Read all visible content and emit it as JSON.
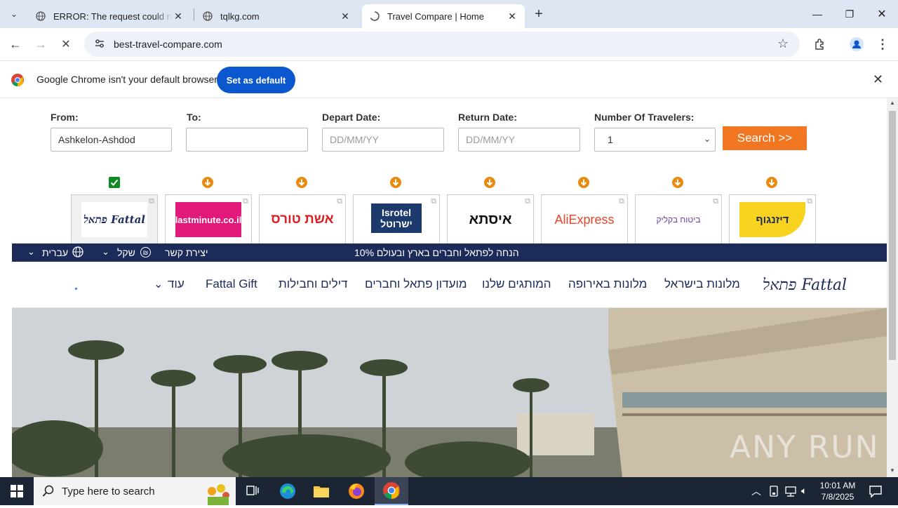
{
  "browser": {
    "tabs": [
      {
        "title": "ERROR: The request could not b",
        "active": false
      },
      {
        "title": "tqlkg.com",
        "active": false
      },
      {
        "title": "Travel Compare | Home",
        "active": true
      }
    ],
    "url": "best-travel-compare.com"
  },
  "infobar": {
    "message": "Google Chrome isn't your default browser",
    "button": "Set as default"
  },
  "form": {
    "from_label": "From:",
    "from_value": "Ashkelon-Ashdod",
    "to_label": "To:",
    "to_value": "",
    "depart_label": "Depart Date:",
    "depart_placeholder": "DD/MM/YY",
    "return_label": "Return Date:",
    "return_placeholder": "DD/MM/YY",
    "travelers_label": "Number Of Travelers:",
    "travelers_value": "1",
    "search_button": "Search >>"
  },
  "providers": [
    {
      "name": "פתאל Fattal",
      "selected": true
    },
    {
      "name": "lastminute.co.il",
      "selected": false
    },
    {
      "name": "אשת טורס",
      "selected": false
    },
    {
      "name": "Isrotel ישרוטל",
      "selected": false
    },
    {
      "name": "איסתא",
      "selected": false
    },
    {
      "name": "AliExpress",
      "selected": false
    },
    {
      "name": "ביטוח בקליק",
      "selected": false
    },
    {
      "name": "דיזנגוף",
      "selected": false
    }
  ],
  "site": {
    "promo_text": "10% הנחה לפתאל וחברים בארץ ובעולם",
    "contact": "יצירת קשר",
    "currency": "שקל",
    "language": "עברית",
    "logo": "פתאל Fattal",
    "nav": [
      "מלונות בישראל",
      "מלונות באירופה",
      "המותגים שלנו",
      "מועדון פתאל וחברים",
      "דילים וחבילות",
      "Fattal Gift",
      "עוד"
    ]
  },
  "watermark": "ANY RUN",
  "taskbar": {
    "search_placeholder": "Type here to search",
    "time": "10:01 AM",
    "date": "7/8/2025"
  },
  "colors": {
    "search_button": "#f17621",
    "promo_bar": "#1c2b5a",
    "chrome_blue": "#0b57d0"
  }
}
